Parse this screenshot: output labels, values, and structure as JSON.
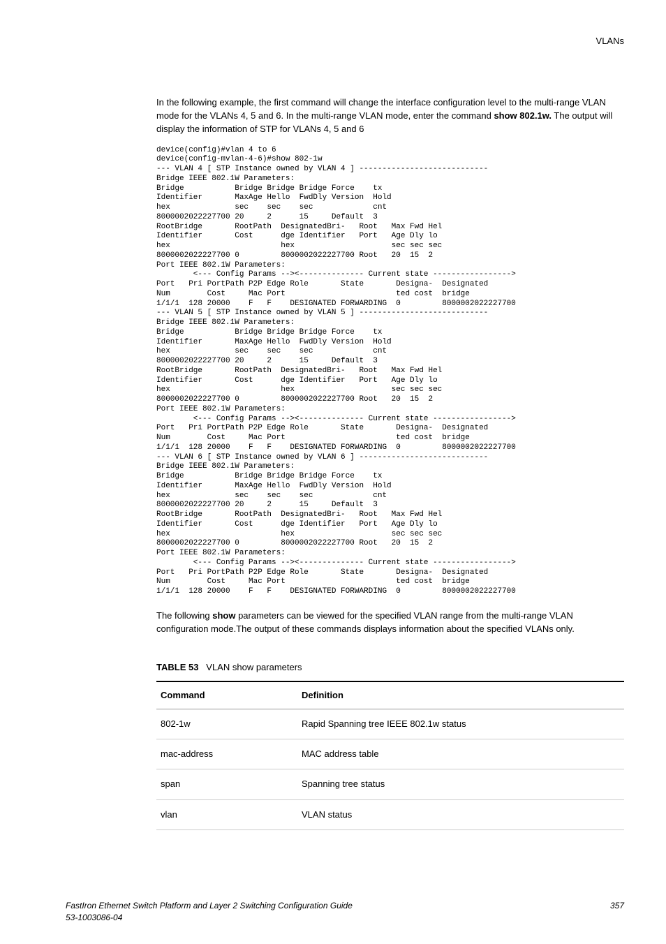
{
  "header": {
    "running_head": "VLANs"
  },
  "intro": {
    "p1_a": "In the following example, the first command will change the interface configuration level to the multi-range VLAN mode for the VLANs 4, 5 and 6. In the multi-range VLAN mode, enter the command ",
    "p1_bold": "show 802.1w.",
    "p1_b": " The output will display the information of STP for VLANs 4, 5 and 6"
  },
  "terminal": "device(config)#vlan 4 to 6\ndevice(config-mvlan-4-6)#show 802-1w\n--- VLAN 4 [ STP Instance owned by VLAN 4 ] ----------------------------\nBridge IEEE 802.1W Parameters:\nBridge           Bridge Bridge Bridge Force    tx\nIdentifier       MaxAge Hello  FwdDly Version  Hold\nhex              sec    sec    sec             cnt\n8000002022227700 20     2      15     Default  3\nRootBridge       RootPath  DesignatedBri-   Root   Max Fwd Hel\nIdentifier       Cost      dge Identifier   Port   Age Dly lo\nhex                        hex                     sec sec sec\n8000002022227700 0         8000002022227700 Root   20  15  2\nPort IEEE 802.1W Parameters:\n        <--- Config Params --><-------------- Current state ----------------->\nPort   Pri PortPath P2P Edge Role       State       Designa-  Designated\nNum        Cost     Mac Port                        ted cost  bridge\n1/1/1  128 20000    F   F    DESIGNATED FORWARDING  0         8000002022227700\n--- VLAN 5 [ STP Instance owned by VLAN 5 ] ----------------------------\nBridge IEEE 802.1W Parameters:\nBridge           Bridge Bridge Bridge Force    tx\nIdentifier       MaxAge Hello  FwdDly Version  Hold\nhex              sec    sec    sec             cnt\n8000002022227700 20     2      15     Default  3\nRootBridge       RootPath  DesignatedBri-   Root   Max Fwd Hel\nIdentifier       Cost      dge Identifier   Port   Age Dly lo\nhex                        hex                     sec sec sec\n8000002022227700 0         8000002022227700 Root   20  15  2\nPort IEEE 802.1W Parameters:\n        <--- Config Params --><-------------- Current state ----------------->\nPort   Pri PortPath P2P Edge Role       State       Designa-  Designated\nNum        Cost     Mac Port                        ted cost  bridge\n1/1/1  128 20000    F   F    DESIGNATED FORWARDING  0         8000002022227700\n--- VLAN 6 [ STP Instance owned by VLAN 6 ] ----------------------------\nBridge IEEE 802.1W Parameters:\nBridge           Bridge Bridge Bridge Force    tx\nIdentifier       MaxAge Hello  FwdDly Version  Hold\nhex              sec    sec    sec             cnt\n8000002022227700 20     2      15     Default  3\nRootBridge       RootPath  DesignatedBri-   Root   Max Fwd Hel\nIdentifier       Cost      dge Identifier   Port   Age Dly lo\nhex                        hex                     sec sec sec\n8000002022227700 0         8000002022227700 Root   20  15  2\nPort IEEE 802.1W Parameters:\n        <--- Config Params --><-------------- Current state ----------------->\nPort   Pri PortPath P2P Edge Role       State       Designa-  Designated\nNum        Cost     Mac Port                        ted cost  bridge\n1/1/1  128 20000    F   F    DESIGNATED FORWARDING  0         8000002022227700",
  "after": {
    "p2_a": "The following ",
    "p2_bold": "show",
    "p2_b": " parameters can be viewed for the specified VLAN range from the multi-range VLAN configuration mode.The output of these commands displays information about the specified VLANs only."
  },
  "table": {
    "label": "TABLE 53",
    "title": "VLAN show parameters",
    "headers": {
      "cmd": "Command",
      "def": "Definition"
    },
    "rows": [
      {
        "cmd": "802-1w",
        "def": "Rapid Spanning tree IEEE 802.1w status"
      },
      {
        "cmd": "mac-address",
        "def": "MAC address table"
      },
      {
        "cmd": "span",
        "def": "Spanning tree status"
      },
      {
        "cmd": "vlan",
        "def": "VLAN status"
      }
    ]
  },
  "footer": {
    "title": "FastIron Ethernet Switch Platform and Layer 2 Switching Configuration Guide",
    "docid": "53-1003086-04",
    "page": "357"
  }
}
